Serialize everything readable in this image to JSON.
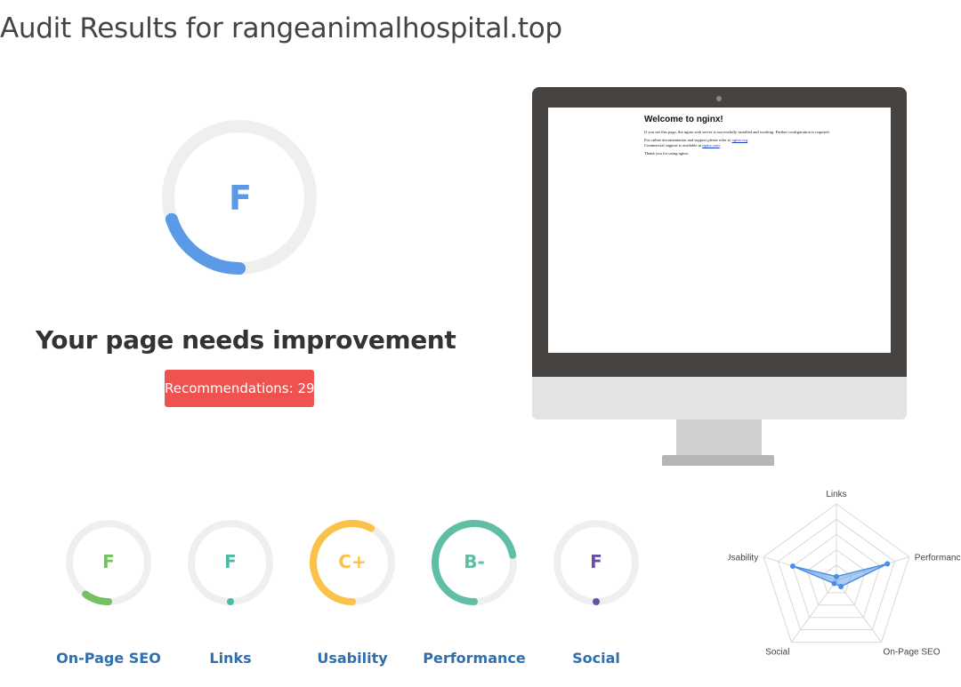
{
  "page": {
    "title": "Audit Results for rangeanimalhospital.top"
  },
  "overall": {
    "grade": "F",
    "score_fraction": 0.2,
    "headline": "Your page needs improvement",
    "recommendations_label": "Recommendations: 29",
    "color": "#5a9ae6"
  },
  "preview": {
    "heading": "Welcome to nginx!",
    "paragraph1": "If you see this page, the nginx web server is successfully installed and working. Further configuration is required.",
    "paragraph2_text": "For online documentation and support please refer to",
    "paragraph2_link": "nginx.org",
    "paragraph2_text2": "Commercial support is available at",
    "paragraph2_link2": "nginx.com",
    "paragraph3": "Thank you for using nginx."
  },
  "categories": [
    {
      "key": "onpage",
      "grade": "F",
      "label": "On-Page SEO",
      "score_fraction": 0.1,
      "color": "#74c160"
    },
    {
      "key": "links",
      "grade": "F",
      "label": "Links",
      "score_fraction": 0.0,
      "color": "#4fb9a6"
    },
    {
      "key": "usability",
      "grade": "C+",
      "label": "Usability",
      "score_fraction": 0.58,
      "color": "#fbc148"
    },
    {
      "key": "performance",
      "grade": "B-",
      "label": "Performance",
      "score_fraction": 0.72,
      "color": "#5fbea4"
    },
    {
      "key": "social",
      "grade": "F",
      "label": "Social",
      "score_fraction": 0.0,
      "color": "#6a4fa8"
    }
  ],
  "radar": {
    "axes": [
      "Links",
      "Performance",
      "On-Page SEO",
      "Social",
      "Usability"
    ],
    "values": [
      0.05,
      0.7,
      0.1,
      0.05,
      0.6
    ],
    "color": "#4a8ee6"
  }
}
